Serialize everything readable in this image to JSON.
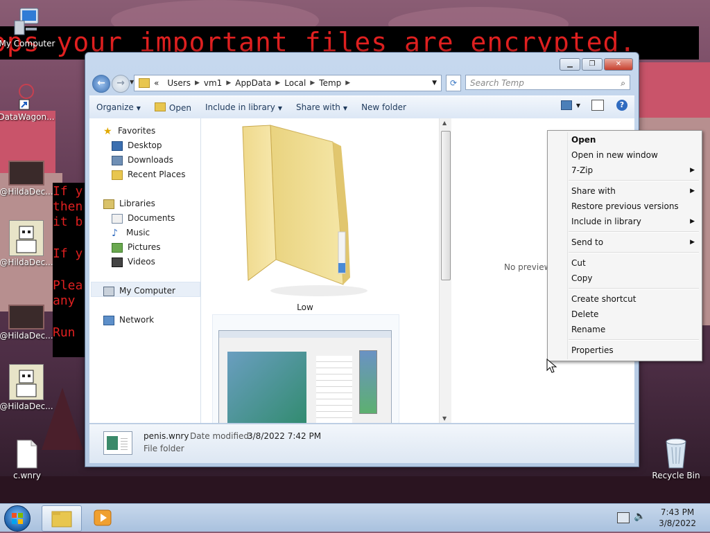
{
  "desktop": {
    "ransom_banner": "ops your important files are encrypted.",
    "ransom_note_lines": [
      "If y",
      "then",
      "it b",
      "If y",
      "Plea",
      "any",
      "Run"
    ],
    "icons": [
      {
        "label": "My Computer",
        "icon": "computer-icon"
      },
      {
        "label": "DataWagon...",
        "icon": "shortcut-icon"
      },
      {
        "label": "@HildaDec...",
        "icon": "bitmap-icon"
      },
      {
        "label": "@HildaDec...",
        "icon": "bitmap-icon"
      },
      {
        "label": "@HildaDec...",
        "icon": "bitmap-icon"
      },
      {
        "label": "@HildaDec...",
        "icon": "bitmap-icon"
      },
      {
        "label": "c.wnry",
        "icon": "file-icon"
      },
      {
        "label": "Recycle Bin",
        "icon": "recycle-bin-icon"
      }
    ]
  },
  "explorer": {
    "breadcrumbs": [
      "Users",
      "vm1",
      "AppData",
      "Local",
      "Temp"
    ],
    "breadcrumb_overflow": "«",
    "search_placeholder": "Search Temp",
    "toolbar": {
      "organize": "Organize",
      "open": "Open",
      "include_in_library": "Include in library",
      "share_with": "Share with",
      "new_folder": "New folder"
    },
    "nav": {
      "favorites": "Favorites",
      "favorites_items": [
        "Desktop",
        "Downloads",
        "Recent Places"
      ],
      "libraries": "Libraries",
      "libraries_items": [
        "Documents",
        "Music",
        "Pictures",
        "Videos"
      ],
      "my_computer": "My Computer",
      "network": "Network"
    },
    "files": [
      {
        "name": "Low",
        "type": "folder"
      },
      {
        "name": "",
        "type": "folder-preview"
      }
    ],
    "preview_text": "No preview",
    "details": {
      "name": "penis.wnry",
      "date_label": "Date modified:",
      "date_value": "3/8/2022 7:42 PM",
      "type": "File folder"
    }
  },
  "context_menu": {
    "items": [
      {
        "label": "Open",
        "bold": true
      },
      {
        "label": "Open in new window"
      },
      {
        "label": "7-Zip",
        "submenu": true
      },
      {
        "label": "Share with",
        "submenu": true
      },
      {
        "label": "Restore previous versions"
      },
      {
        "label": "Include in library",
        "submenu": true
      },
      {
        "label": "Send to",
        "submenu": true
      },
      {
        "label": "Cut"
      },
      {
        "label": "Copy"
      },
      {
        "label": "Create shortcut"
      },
      {
        "label": "Delete"
      },
      {
        "label": "Rename"
      },
      {
        "label": "Properties"
      }
    ]
  },
  "taskbar": {
    "time": "7:43 PM",
    "date": "3/8/2022"
  },
  "colors": {
    "ransom_red": "#e02020",
    "taskbar": "#b9cde5",
    "window_frame": "#c6d8ee"
  }
}
